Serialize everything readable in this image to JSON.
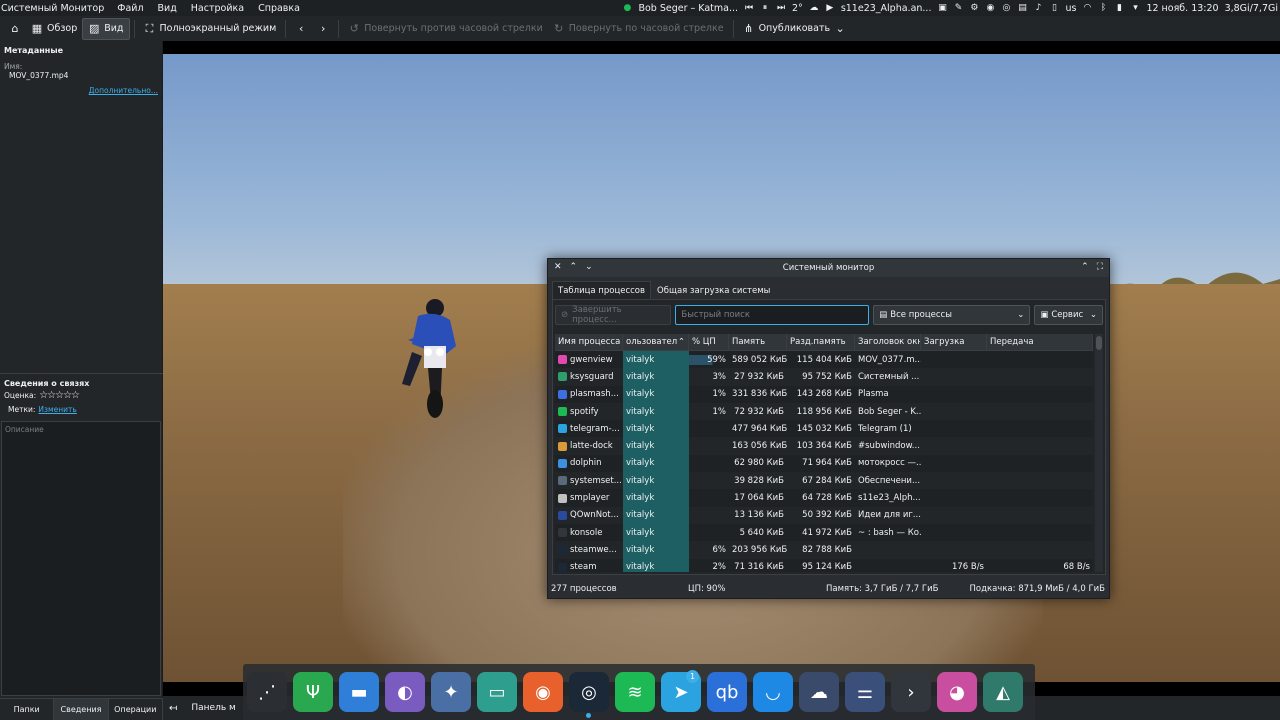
{
  "topbar": {
    "app_title": "Системный Монитор",
    "menu": [
      "Файл",
      "Вид",
      "Настройка",
      "Справка"
    ],
    "media_title": "Bob Seger – Katma...",
    "weather": "2°",
    "task_title": "s11e23_Alpha.an...",
    "keyboard": "us",
    "datetime": "12 нояб. 13:20",
    "memory": "3,8Gi/7,7Gi"
  },
  "toolbar": {
    "overview": "Обзор",
    "view": "Вид",
    "fullscreen": "Полноэкранный режим",
    "rotate_ccw": "Повернуть против часовой стрелки",
    "rotate_cw": "Повернуть по часовой стрелке",
    "publish": "Опубликовать"
  },
  "sidebar": {
    "metadata_title": "Метаданные",
    "name_label": "Имя:",
    "file_name": "MOV_0377.mp4",
    "more_link": "Дополнительно...",
    "relations_title": "Сведения о связях",
    "rating_label": "Оценка:",
    "rating_stars": "☆☆☆☆☆",
    "tags_label": "Метки:",
    "tags_link": "Изменить",
    "description_placeholder": "Описание",
    "tabs": [
      "Папки",
      "Сведения",
      "Операции"
    ]
  },
  "viewer_bottom": {
    "panel_label": "Панель м"
  },
  "sysmon": {
    "title": "Системный монитор",
    "tabs": [
      "Таблица процессов",
      "Общая загрузка системы"
    ],
    "kill_button": "Завершить процесс...",
    "search_placeholder": "Быстрый поиск",
    "filter_value": "Все процессы",
    "service_button": "Сервис",
    "columns": [
      "Имя процесса",
      "ользовател",
      "% ЦП",
      "Память",
      "Разд.память",
      "Заголовок окн",
      "Загрузка",
      "Передача"
    ],
    "rows": [
      {
        "name": "gwenview",
        "user": "vitalyk",
        "cpu": "59%",
        "mem": "589 052 КиБ",
        "shm": "115 404 КиБ",
        "win": "MOV_0377.m...",
        "dl": "",
        "ul": "",
        "color": "#e04ab0"
      },
      {
        "name": "ksysguard",
        "user": "vitalyk",
        "cpu": "3%",
        "mem": "27 932 КиБ",
        "shm": "95 752 КиБ",
        "win": "Системный ...",
        "dl": "",
        "ul": "",
        "color": "#2e9e6a"
      },
      {
        "name": "plasmash...",
        "user": "vitalyk",
        "cpu": "1%",
        "mem": "331 836 КиБ",
        "shm": "143 268 КиБ",
        "win": "Plasma",
        "dl": "",
        "ul": "",
        "color": "#3d6fe0"
      },
      {
        "name": "spotify",
        "user": "vitalyk",
        "cpu": "1%",
        "mem": "72 932 КиБ",
        "shm": "118 956 КиБ",
        "win": "Bob Seger - K...",
        "dl": "",
        "ul": "",
        "color": "#1db954"
      },
      {
        "name": "telegram-...",
        "user": "vitalyk",
        "cpu": "",
        "mem": "477 964 КиБ",
        "shm": "145 032 КиБ",
        "win": "Telegram (1)",
        "dl": "",
        "ul": "",
        "color": "#2aa3e0"
      },
      {
        "name": "latte-dock",
        "user": "vitalyk",
        "cpu": "",
        "mem": "163 056 КиБ",
        "shm": "103 364 КиБ",
        "win": "#subwindow...",
        "dl": "",
        "ul": "",
        "color": "#d99a3a"
      },
      {
        "name": "dolphin",
        "user": "vitalyk",
        "cpu": "",
        "mem": "62 980 КиБ",
        "shm": "71 964 КиБ",
        "win": "мотокросс —...",
        "dl": "",
        "ul": "",
        "color": "#3d8fe0"
      },
      {
        "name": "systemset...",
        "user": "vitalyk",
        "cpu": "",
        "mem": "39 828 КиБ",
        "shm": "67 284 КиБ",
        "win": "Обеспечени...",
        "dl": "",
        "ul": "",
        "color": "#5a6a7a"
      },
      {
        "name": "smplayer",
        "user": "vitalyk",
        "cpu": "",
        "mem": "17 064 КиБ",
        "shm": "64 728 КиБ",
        "win": "s11e23_Alph...",
        "dl": "",
        "ul": "",
        "color": "#c0c0c0"
      },
      {
        "name": "QOwnNot...",
        "user": "vitalyk",
        "cpu": "",
        "mem": "13 136 КиБ",
        "shm": "50 392 КиБ",
        "win": "Идеи для иг...",
        "dl": "",
        "ul": "",
        "color": "#2a4aa0"
      },
      {
        "name": "konsole",
        "user": "vitalyk",
        "cpu": "",
        "mem": "5 640 КиБ",
        "shm": "41 972 КиБ",
        "win": "~ : bash — Ко...",
        "dl": "",
        "ul": "",
        "color": "#30363c"
      },
      {
        "name": "steamwe...",
        "user": "vitalyk",
        "cpu": "6%",
        "mem": "203 956 КиБ",
        "shm": "82 788 КиБ",
        "win": "",
        "dl": "",
        "ul": "",
        "color": "#1b2838"
      },
      {
        "name": "steam",
        "user": "vitalyk",
        "cpu": "2%",
        "mem": "71 316 КиБ",
        "shm": "95 124 КиБ",
        "win": "",
        "dl": "176 B/s",
        "ul": "68 B/s",
        "color": "#1b2838"
      }
    ],
    "status": {
      "processes": "277 процессов",
      "cpu": "ЦП: 90%",
      "memory": "Память: 3,7 ГиБ / 7,7 ГиБ",
      "swap": "Подкачка: 871,9 МиБ / 4,0 ГиБ"
    }
  },
  "dock": {
    "apps": [
      {
        "icon": "kde-connect-icon",
        "glyph": "⋰"
      },
      {
        "icon": "qownnotes-icon",
        "glyph": "Ψ"
      },
      {
        "icon": "dolphin-icon",
        "glyph": "▬"
      },
      {
        "icon": "disk-icon",
        "glyph": "◐"
      },
      {
        "icon": "gamepad-icon",
        "glyph": "✦"
      },
      {
        "icon": "terminal-app-icon",
        "glyph": "▭"
      },
      {
        "icon": "firefox-icon",
        "glyph": "◉"
      },
      {
        "icon": "steam-icon",
        "glyph": "◎"
      },
      {
        "icon": "spotify-icon",
        "glyph": "≋"
      },
      {
        "icon": "telegram-icon",
        "glyph": "➤"
      },
      {
        "icon": "qbittorrent-icon",
        "glyph": "qb"
      },
      {
        "icon": "krunner-icon",
        "glyph": "◡"
      },
      {
        "icon": "cloud-icon",
        "glyph": "☁"
      },
      {
        "icon": "settings-icon",
        "glyph": "⚌"
      },
      {
        "icon": "konsole-icon",
        "glyph": "›"
      },
      {
        "icon": "gwenview-icon",
        "glyph": "◕"
      },
      {
        "icon": "ksysguard-icon",
        "glyph": "◭"
      }
    ],
    "telegram_badge": "1"
  }
}
